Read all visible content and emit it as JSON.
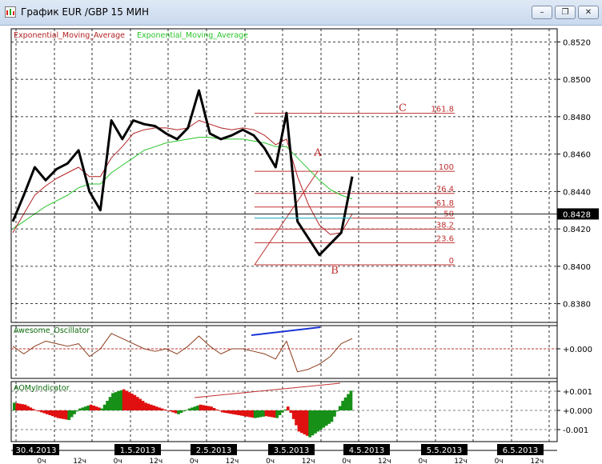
{
  "window": {
    "title": "График EUR /GBP  15 МИН",
    "minimize_label": "–",
    "restore_label": "❐",
    "close_label": "✕"
  },
  "colors": {
    "price": "#000000",
    "ema_red": "#b22222",
    "ema_green": "#2cc52c",
    "fib": "#c03030",
    "cyan": "#22c8e0",
    "ao_up": "#169016",
    "ao_down": "#e01010",
    "blue": "#1a35d6"
  },
  "main_panel": {
    "indicator_label_1": "Exponential_Moving_Average",
    "indicator_label_2": "Exponential_Moving_Average",
    "price_ticks": [
      "0.8520",
      "0.8500",
      "0.8480",
      "0.8460",
      "0.8440",
      "0.8420",
      "0.8400",
      "0.8380"
    ],
    "current_price": "0.8428"
  },
  "fib_levels": [
    {
      "label": "161.8",
      "price": 0.84818
    },
    {
      "label": "100",
      "price": 0.84508
    },
    {
      "label": "76.4",
      "price": 0.8439
    },
    {
      "label": "61.8",
      "price": 0.84317
    },
    {
      "label": "50",
      "price": 0.84258
    },
    {
      "label": "38.2",
      "price": 0.84199
    },
    {
      "label": "23.6",
      "price": 0.84126
    },
    {
      "label": "0",
      "price": 0.84008
    }
  ],
  "wave_labels": {
    "a": "A",
    "b": "B",
    "c": "C"
  },
  "ao_panel": {
    "label": "Awesome_Oscillator",
    "ticks": [
      "+0.000"
    ]
  },
  "aomy_panel": {
    "label": "AOMyIndicator",
    "ticks": [
      "+0.001",
      "+0.000",
      "-0.001"
    ]
  },
  "dates": [
    "30.4.2013",
    "1.5.2013",
    "2.5.2013",
    "3.5.2013",
    "4.5.2013",
    "5.5.2013",
    "6.5.2013"
  ],
  "time_labels": [
    "0ч",
    "12ч",
    "0ч",
    "12ч",
    "0ч",
    "12ч",
    "0ч",
    "12ч",
    "0ч",
    "12ч",
    "0ч",
    "12ч",
    "0ч",
    "12ч"
  ],
  "chart_data": {
    "type": "line",
    "title": "",
    "ylim": [
      0.837,
      0.8527
    ],
    "series": [
      {
        "name": "price",
        "x": [
          "30.4 00:00",
          "30.4 03:00",
          "30.4 06:00",
          "30.4 09:00",
          "30.4 12:00",
          "30.4 15:00",
          "30.4 18:00",
          "30.4 21:00",
          "1.5 00:00",
          "1.5 03:00",
          "1.5 06:00",
          "1.5 09:00",
          "1.5 12:00",
          "1.5 15:00",
          "1.5 18:00",
          "1.5 21:00",
          "2.5 00:00",
          "2.5 03:00",
          "2.5 06:00",
          "2.5 09:00",
          "2.5 12:00",
          "2.5 15:00",
          "2.5 18:00",
          "2.5 21:00",
          "3.5 00:00",
          "3.5 03:00",
          "3.5 06:00",
          "3.5 09:00",
          "3.5 12:00",
          "3.5 15:00",
          "3.5 18:00",
          "3.5 21:00"
        ],
        "values": [
          0.8424,
          0.8438,
          0.8453,
          0.8446,
          0.8452,
          0.8455,
          0.8462,
          0.844,
          0.843,
          0.8478,
          0.8468,
          0.8478,
          0.8476,
          0.8475,
          0.8471,
          0.8468,
          0.8474,
          0.8494,
          0.8471,
          0.8468,
          0.847,
          0.8473,
          0.847,
          0.8463,
          0.8453,
          0.8482,
          0.8424,
          0.8415,
          0.8406,
          0.8412,
          0.8418,
          0.8448
        ]
      },
      {
        "name": "ema_red",
        "values": [
          0.8418,
          0.8428,
          0.8438,
          0.8443,
          0.8447,
          0.845,
          0.8453,
          0.8448,
          0.8448,
          0.8458,
          0.8464,
          0.8471,
          0.8473,
          0.8474,
          0.8474,
          0.8473,
          0.8474,
          0.8478,
          0.8476,
          0.8474,
          0.8473,
          0.8474,
          0.8473,
          0.847,
          0.8465,
          0.8468,
          0.8448,
          0.8433,
          0.8422,
          0.8417,
          0.8418,
          0.8428
        ]
      },
      {
        "name": "ema_green",
        "values": [
          0.842,
          0.8424,
          0.8428,
          0.8432,
          0.8435,
          0.8438,
          0.8442,
          0.8444,
          0.8444,
          0.845,
          0.8454,
          0.8458,
          0.8462,
          0.8464,
          0.8466,
          0.8467,
          0.8468,
          0.8469,
          0.8469,
          0.8468,
          0.8468,
          0.8468,
          0.8467,
          0.8466,
          0.8464,
          0.8464,
          0.8458,
          0.8452,
          0.8446,
          0.8441,
          0.8438,
          0.8436
        ]
      },
      {
        "name": "awesome_oscillator",
        "values": [
          0.0001,
          -0.0002,
          0.0001,
          0.0003,
          0.0002,
          0.0001,
          0.0002,
          -0.0003,
          0.0,
          0.0006,
          0.0004,
          0.0002,
          0.0,
          -0.0001,
          0.0,
          -0.0002,
          0.0001,
          0.0005,
          0.0001,
          -0.0002,
          0.0,
          0.0,
          -0.0001,
          -0.0002,
          -0.0004,
          0.0003,
          -0.0009,
          -0.0008,
          -0.0006,
          -0.0003,
          0.0002,
          0.0004
        ]
      },
      {
        "name": "aomy_indicator",
        "values": [
          0.0004,
          0.0003,
          0.0,
          -0.0002,
          -0.0004,
          -0.0005,
          0.0001,
          0.0003,
          0.0001,
          0.0009,
          0.0011,
          0.0008,
          0.0004,
          0.0002,
          0.0,
          -0.0002,
          0.0001,
          0.0003,
          0.0002,
          -0.0001,
          -0.0002,
          -0.0003,
          -0.0004,
          -0.0003,
          -0.0004,
          0.0002,
          -0.0011,
          -0.0014,
          -0.001,
          -0.0006,
          0.0005,
          0.0012
        ]
      }
    ]
  }
}
